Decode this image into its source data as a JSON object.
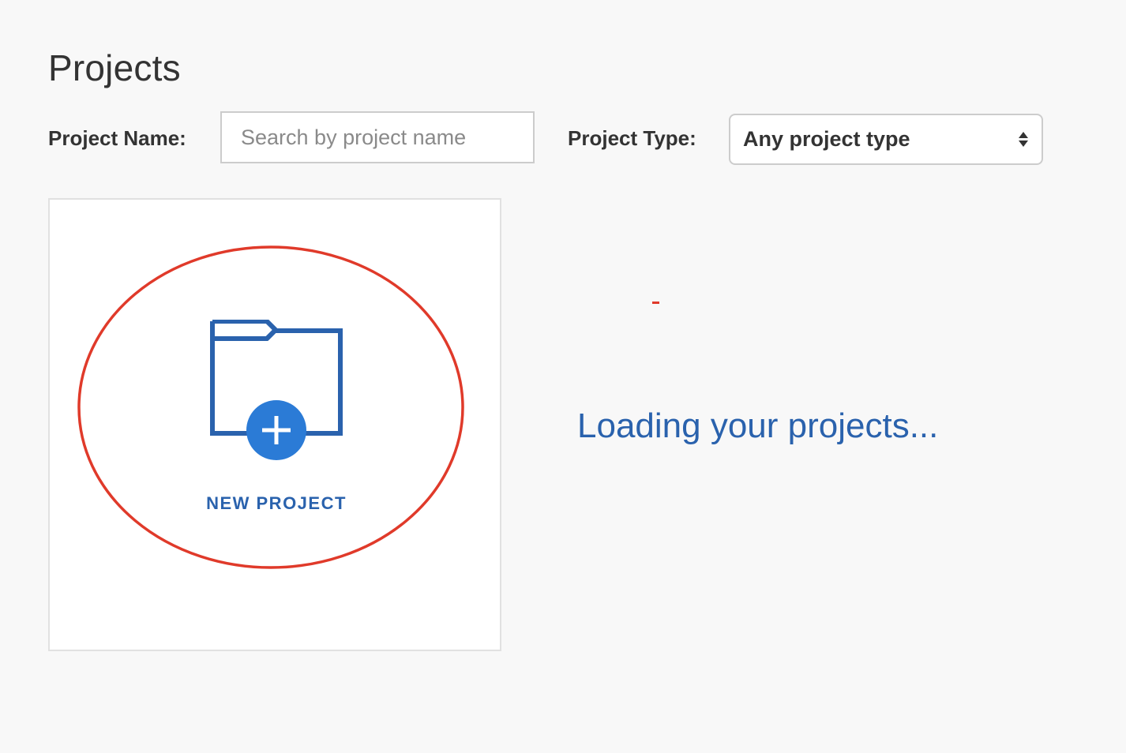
{
  "page": {
    "title": "Projects"
  },
  "filters": {
    "project_name_label": "Project Name:",
    "project_name_placeholder": "Search by project name",
    "project_name_value": "",
    "project_type_label": "Project Type:",
    "project_type_selected": "Any project type"
  },
  "new_project_card": {
    "label": "NEW PROJECT",
    "icon": "folder-plus-icon"
  },
  "loading": {
    "message": "Loading your projects..."
  },
  "colors": {
    "accent_blue": "#2a62ad",
    "plus_circle_blue": "#2b7bd6",
    "annotation_red": "#e03a2a",
    "background": "#f8f8f8"
  }
}
